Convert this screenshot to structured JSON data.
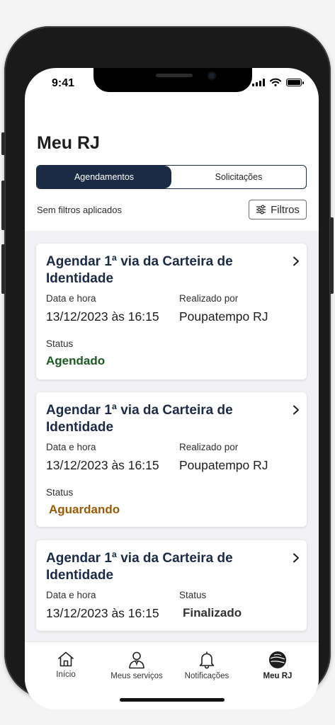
{
  "status_bar": {
    "time": "9:41"
  },
  "page": {
    "title": "Meu RJ",
    "tabs": [
      {
        "label": "Agendamentos",
        "active": true
      },
      {
        "label": "Solicitações",
        "active": false
      }
    ],
    "filter_status": "Sem filtros aplicados",
    "filter_button": "Filtros"
  },
  "cards": [
    {
      "title": "Agendar 1ª via da Carteira de Identidade",
      "date_label": "Data e hora",
      "date_value": "13/12/2023 às 16:15",
      "by_label": "Realizado por",
      "by_value": "Poupatempo RJ",
      "status_label": "Status",
      "status_value": "Agendado",
      "status_color": "#1d5a23"
    },
    {
      "title": "Agendar 1ª via da Carteira de Identidade",
      "date_label": "Data e hora",
      "date_value": "13/12/2023 às 16:15",
      "by_label": "Realizado por",
      "by_value": "Poupatempo RJ",
      "status_label": "Status",
      "status_value": "Aguardando",
      "status_color": "#9a5a00"
    },
    {
      "title": "Agendar 1ª via da Carteira de Identidade",
      "date_label": "Data e hora",
      "date_value": "13/12/2023 às 16:15",
      "status_label": "Status",
      "status_value": "Finalizado",
      "status_color": "#333333"
    }
  ],
  "tabbar": [
    {
      "label": "Início",
      "icon": "home-icon"
    },
    {
      "label": "Meus serviços",
      "icon": "services-person-icon"
    },
    {
      "label": "Notificações",
      "icon": "bell-icon"
    },
    {
      "label": "Meu RJ",
      "icon": "rj-globe-icon",
      "active": true
    }
  ],
  "colors": {
    "primary": "#1b2b45",
    "accent_dark": "#1b2b45"
  }
}
